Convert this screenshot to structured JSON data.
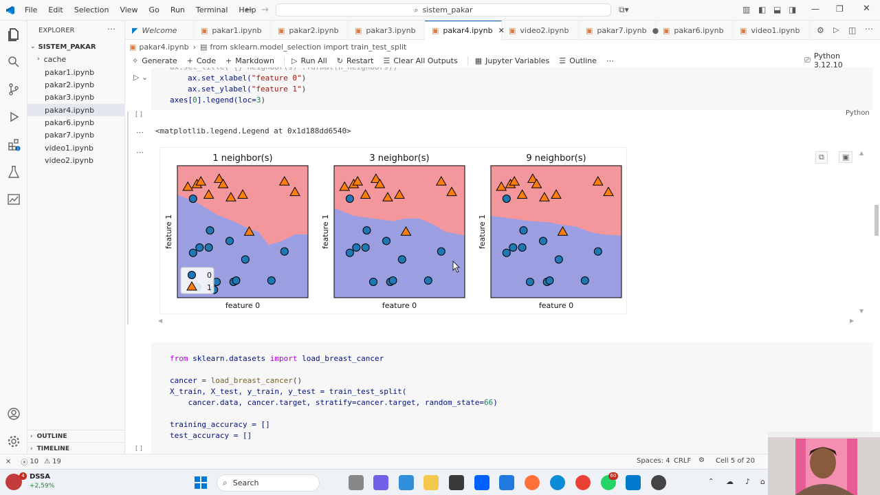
{
  "menu": [
    "File",
    "Edit",
    "Selection",
    "View",
    "Go",
    "Run",
    "Terminal",
    "Help"
  ],
  "search": {
    "text": "sistem_pakar"
  },
  "explorer": {
    "title": "EXPLORER",
    "root": "SISTEM_PAKAR",
    "items": [
      "cache",
      "pakar1.ipynb",
      "pakar2.ipynb",
      "pakar3.ipynb",
      "pakar4.ipynb",
      "pakar6.ipynb",
      "pakar7.ipynb",
      "video1.ipynb",
      "video2.ipynb"
    ],
    "outline": "OUTLINE",
    "timeline": "TIMELINE"
  },
  "tabs": [
    "Welcome",
    "pakar1.ipynb",
    "pakar2.ipynb",
    "pakar3.ipynb",
    "pakar4.ipynb",
    "video2.ipynb",
    "pakar7.ipynb",
    "pakar6.ipynb",
    "video1.ipynb"
  ],
  "breadcrumb": {
    "file": "pakar4.ipynb",
    "sep": "›",
    "symbol": "from sklearn.model_selection import train_test_split"
  },
  "toolbar": {
    "generate": "Generate",
    "code": "Code",
    "markdown": "Markdown",
    "run_all": "Run All",
    "restart": "Restart",
    "clear": "Clear All Outputs",
    "variables": "Jupyter Variables",
    "outline": "Outline",
    "kernel": "Python 3.12.10"
  },
  "cell1": {
    "line0": "ax.set_title(\"{} neighbor(s)\".format(n_neighbors))",
    "line1a": "ax.set_xlabel(",
    "line1b": "\"feature 0\"",
    "line1c": ")",
    "line2a": "ax.set_ylabel(",
    "line2b": "\"feature 1\"",
    "line2c": ")",
    "line3a": "axes[",
    "line3b": "0",
    "line3c": "].legend(loc=",
    "line3d": "3",
    "line3e": ")",
    "bracket": "[ ]",
    "lang": "Python"
  },
  "output": {
    "text": "<matplotlib.legend.Legend at 0x1d188dd6540>"
  },
  "chart_data": [
    {
      "type": "scatter",
      "title": "1 neighbor(s)",
      "xlabel": "feature 0",
      "ylabel": "feature 1",
      "legend": [
        "0",
        "1"
      ],
      "legend_position": "lower-left",
      "class1_region_color": "#f4979c",
      "class0_region_color": "#9b9ee0",
      "boundary": [
        [
          0,
          0.78
        ],
        [
          0.15,
          0.72
        ],
        [
          0.3,
          0.63
        ],
        [
          0.45,
          0.57
        ],
        [
          0.55,
          0.52
        ],
        [
          0.62,
          0.5
        ],
        [
          0.7,
          0.4
        ],
        [
          0.8,
          0.43
        ],
        [
          0.9,
          0.48
        ],
        [
          1,
          0.48
        ]
      ],
      "class1_points": [
        [
          0.08,
          0.84
        ],
        [
          0.15,
          0.86
        ],
        [
          0.18,
          0.88
        ],
        [
          0.24,
          0.78
        ],
        [
          0.32,
          0.9
        ],
        [
          0.35,
          0.86
        ],
        [
          0.41,
          0.76
        ],
        [
          0.5,
          0.78
        ],
        [
          0.55,
          0.5
        ],
        [
          0.82,
          0.88
        ],
        [
          0.9,
          0.8
        ]
      ],
      "class0_points": [
        [
          0.12,
          0.75
        ],
        [
          0.25,
          0.51
        ],
        [
          0.17,
          0.38
        ],
        [
          0.12,
          0.34
        ],
        [
          0.24,
          0.38
        ],
        [
          0.4,
          0.43
        ],
        [
          0.52,
          0.29
        ],
        [
          0.82,
          0.35
        ],
        [
          0.3,
          0.12
        ],
        [
          0.43,
          0.12
        ],
        [
          0.45,
          0.13
        ],
        [
          0.72,
          0.13
        ],
        [
          0.15,
          0.08
        ],
        [
          0.28,
          0.06
        ]
      ]
    },
    {
      "type": "scatter",
      "title": "3 neighbor(s)",
      "xlabel": "feature 0",
      "ylabel": "feature 1",
      "class1_region_color": "#f4979c",
      "class0_region_color": "#9b9ee0",
      "boundary": [
        [
          0,
          0.68
        ],
        [
          0.15,
          0.62
        ],
        [
          0.3,
          0.6
        ],
        [
          0.45,
          0.58
        ],
        [
          0.55,
          0.6
        ],
        [
          0.65,
          0.6
        ],
        [
          0.75,
          0.56
        ],
        [
          0.85,
          0.5
        ],
        [
          1,
          0.47
        ]
      ],
      "class1_points": [
        [
          0.08,
          0.84
        ],
        [
          0.15,
          0.86
        ],
        [
          0.18,
          0.88
        ],
        [
          0.24,
          0.78
        ],
        [
          0.32,
          0.9
        ],
        [
          0.35,
          0.86
        ],
        [
          0.41,
          0.76
        ],
        [
          0.5,
          0.78
        ],
        [
          0.55,
          0.5
        ],
        [
          0.82,
          0.88
        ],
        [
          0.9,
          0.8
        ]
      ],
      "class0_points": [
        [
          0.12,
          0.75
        ],
        [
          0.25,
          0.51
        ],
        [
          0.17,
          0.38
        ],
        [
          0.12,
          0.34
        ],
        [
          0.24,
          0.38
        ],
        [
          0.4,
          0.43
        ],
        [
          0.52,
          0.29
        ],
        [
          0.82,
          0.35
        ],
        [
          0.3,
          0.12
        ],
        [
          0.43,
          0.12
        ],
        [
          0.45,
          0.13
        ],
        [
          0.72,
          0.13
        ]
      ]
    },
    {
      "type": "scatter",
      "title": "9 neighbor(s)",
      "xlabel": "feature 0",
      "ylabel": "feature 1",
      "class1_region_color": "#f4979c",
      "class0_region_color": "#9b9ee0",
      "boundary": [
        [
          0,
          0.62
        ],
        [
          0.15,
          0.6
        ],
        [
          0.3,
          0.58
        ],
        [
          0.45,
          0.57
        ],
        [
          0.55,
          0.55
        ],
        [
          0.65,
          0.54
        ],
        [
          0.75,
          0.5
        ],
        [
          0.85,
          0.48
        ],
        [
          1,
          0.47
        ]
      ],
      "class1_points": [
        [
          0.08,
          0.84
        ],
        [
          0.15,
          0.86
        ],
        [
          0.18,
          0.88
        ],
        [
          0.24,
          0.78
        ],
        [
          0.32,
          0.9
        ],
        [
          0.35,
          0.86
        ],
        [
          0.41,
          0.76
        ],
        [
          0.5,
          0.78
        ],
        [
          0.55,
          0.5
        ],
        [
          0.82,
          0.88
        ],
        [
          0.9,
          0.8
        ]
      ],
      "class0_points": [
        [
          0.12,
          0.75
        ],
        [
          0.25,
          0.51
        ],
        [
          0.17,
          0.38
        ],
        [
          0.12,
          0.34
        ],
        [
          0.24,
          0.38
        ],
        [
          0.4,
          0.43
        ],
        [
          0.52,
          0.29
        ],
        [
          0.82,
          0.35
        ],
        [
          0.3,
          0.12
        ],
        [
          0.43,
          0.12
        ],
        [
          0.45,
          0.13
        ],
        [
          0.72,
          0.13
        ]
      ]
    }
  ],
  "cell2": {
    "l1a": "from",
    "l1b": " sklearn.datasets ",
    "l1c": "import",
    "l1d": " load_breast_cancer",
    "l3a": "cancer",
    "l3b": " = ",
    "l3c": "load_breast_cancer",
    "l3d": "()",
    "l4": "X_train, X_test, y_train, y_test = train_test_split(",
    "l5a": "    cancer.data, cancer.target, stratify=cancer.target, random_state=",
    "l5b": "66",
    "l5c": ")",
    "l7": "training_accuracy = []",
    "l8": "test_accuracy = []",
    "bracket": "[ ]"
  },
  "status": {
    "errors": "10",
    "warnings": "19",
    "spaces": "Spaces: 4",
    "eol": "CRLF",
    "cell": "Cell 5 of 20"
  },
  "taskbar": {
    "stock_name": "DSSA",
    "stock_change": "+2,59%",
    "badge": "4",
    "search": "Search",
    "wa_badge": "60"
  }
}
